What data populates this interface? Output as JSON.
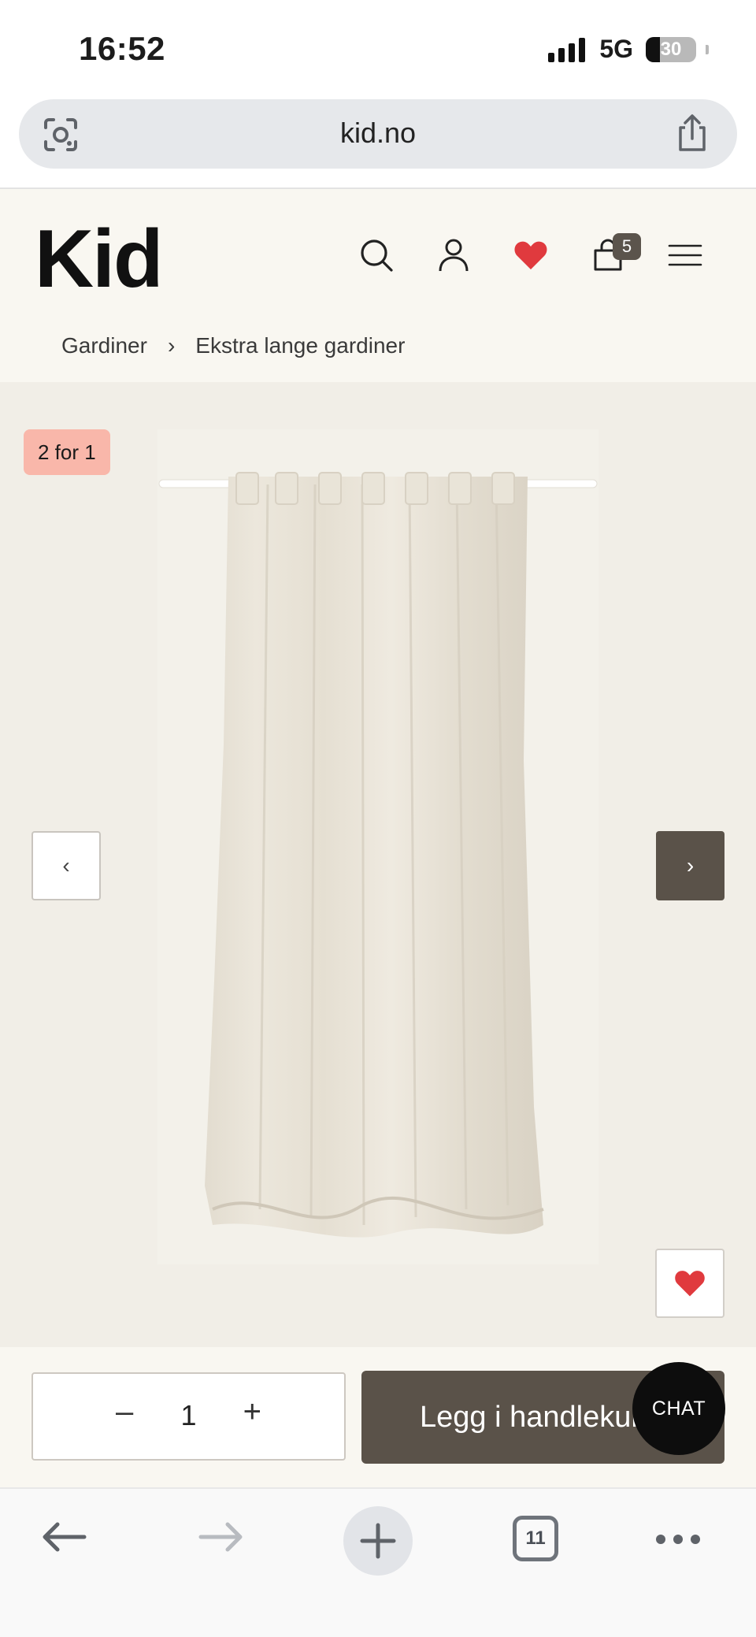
{
  "status_bar": {
    "time": "16:52",
    "network": "5G",
    "battery": "30",
    "battery_level": 0.3
  },
  "browser": {
    "url": "kid.no",
    "tab_count": "11"
  },
  "header": {
    "logo": "Kid",
    "cart_count": "5",
    "icons": [
      "search-icon",
      "account-icon",
      "heart-icon",
      "cart-icon",
      "menu-icon"
    ]
  },
  "breadcrumb": {
    "items": [
      "Gardiner",
      "Ekstra lange gardiner"
    ]
  },
  "product": {
    "promo_badge": "2 for 1",
    "prev_glyph": "‹",
    "next_glyph": "›"
  },
  "purchase": {
    "minus": "–",
    "quantity": "1",
    "plus": "+",
    "add_to_cart": "Legg i handlekurv",
    "chat": "CHAT"
  },
  "colors": {
    "header_bg": "#f9f7f1",
    "product_bg": "#f1eee7",
    "brand_dark": "#5a5249",
    "promo": "#f9b7aa",
    "heart": "#e03a3e"
  }
}
